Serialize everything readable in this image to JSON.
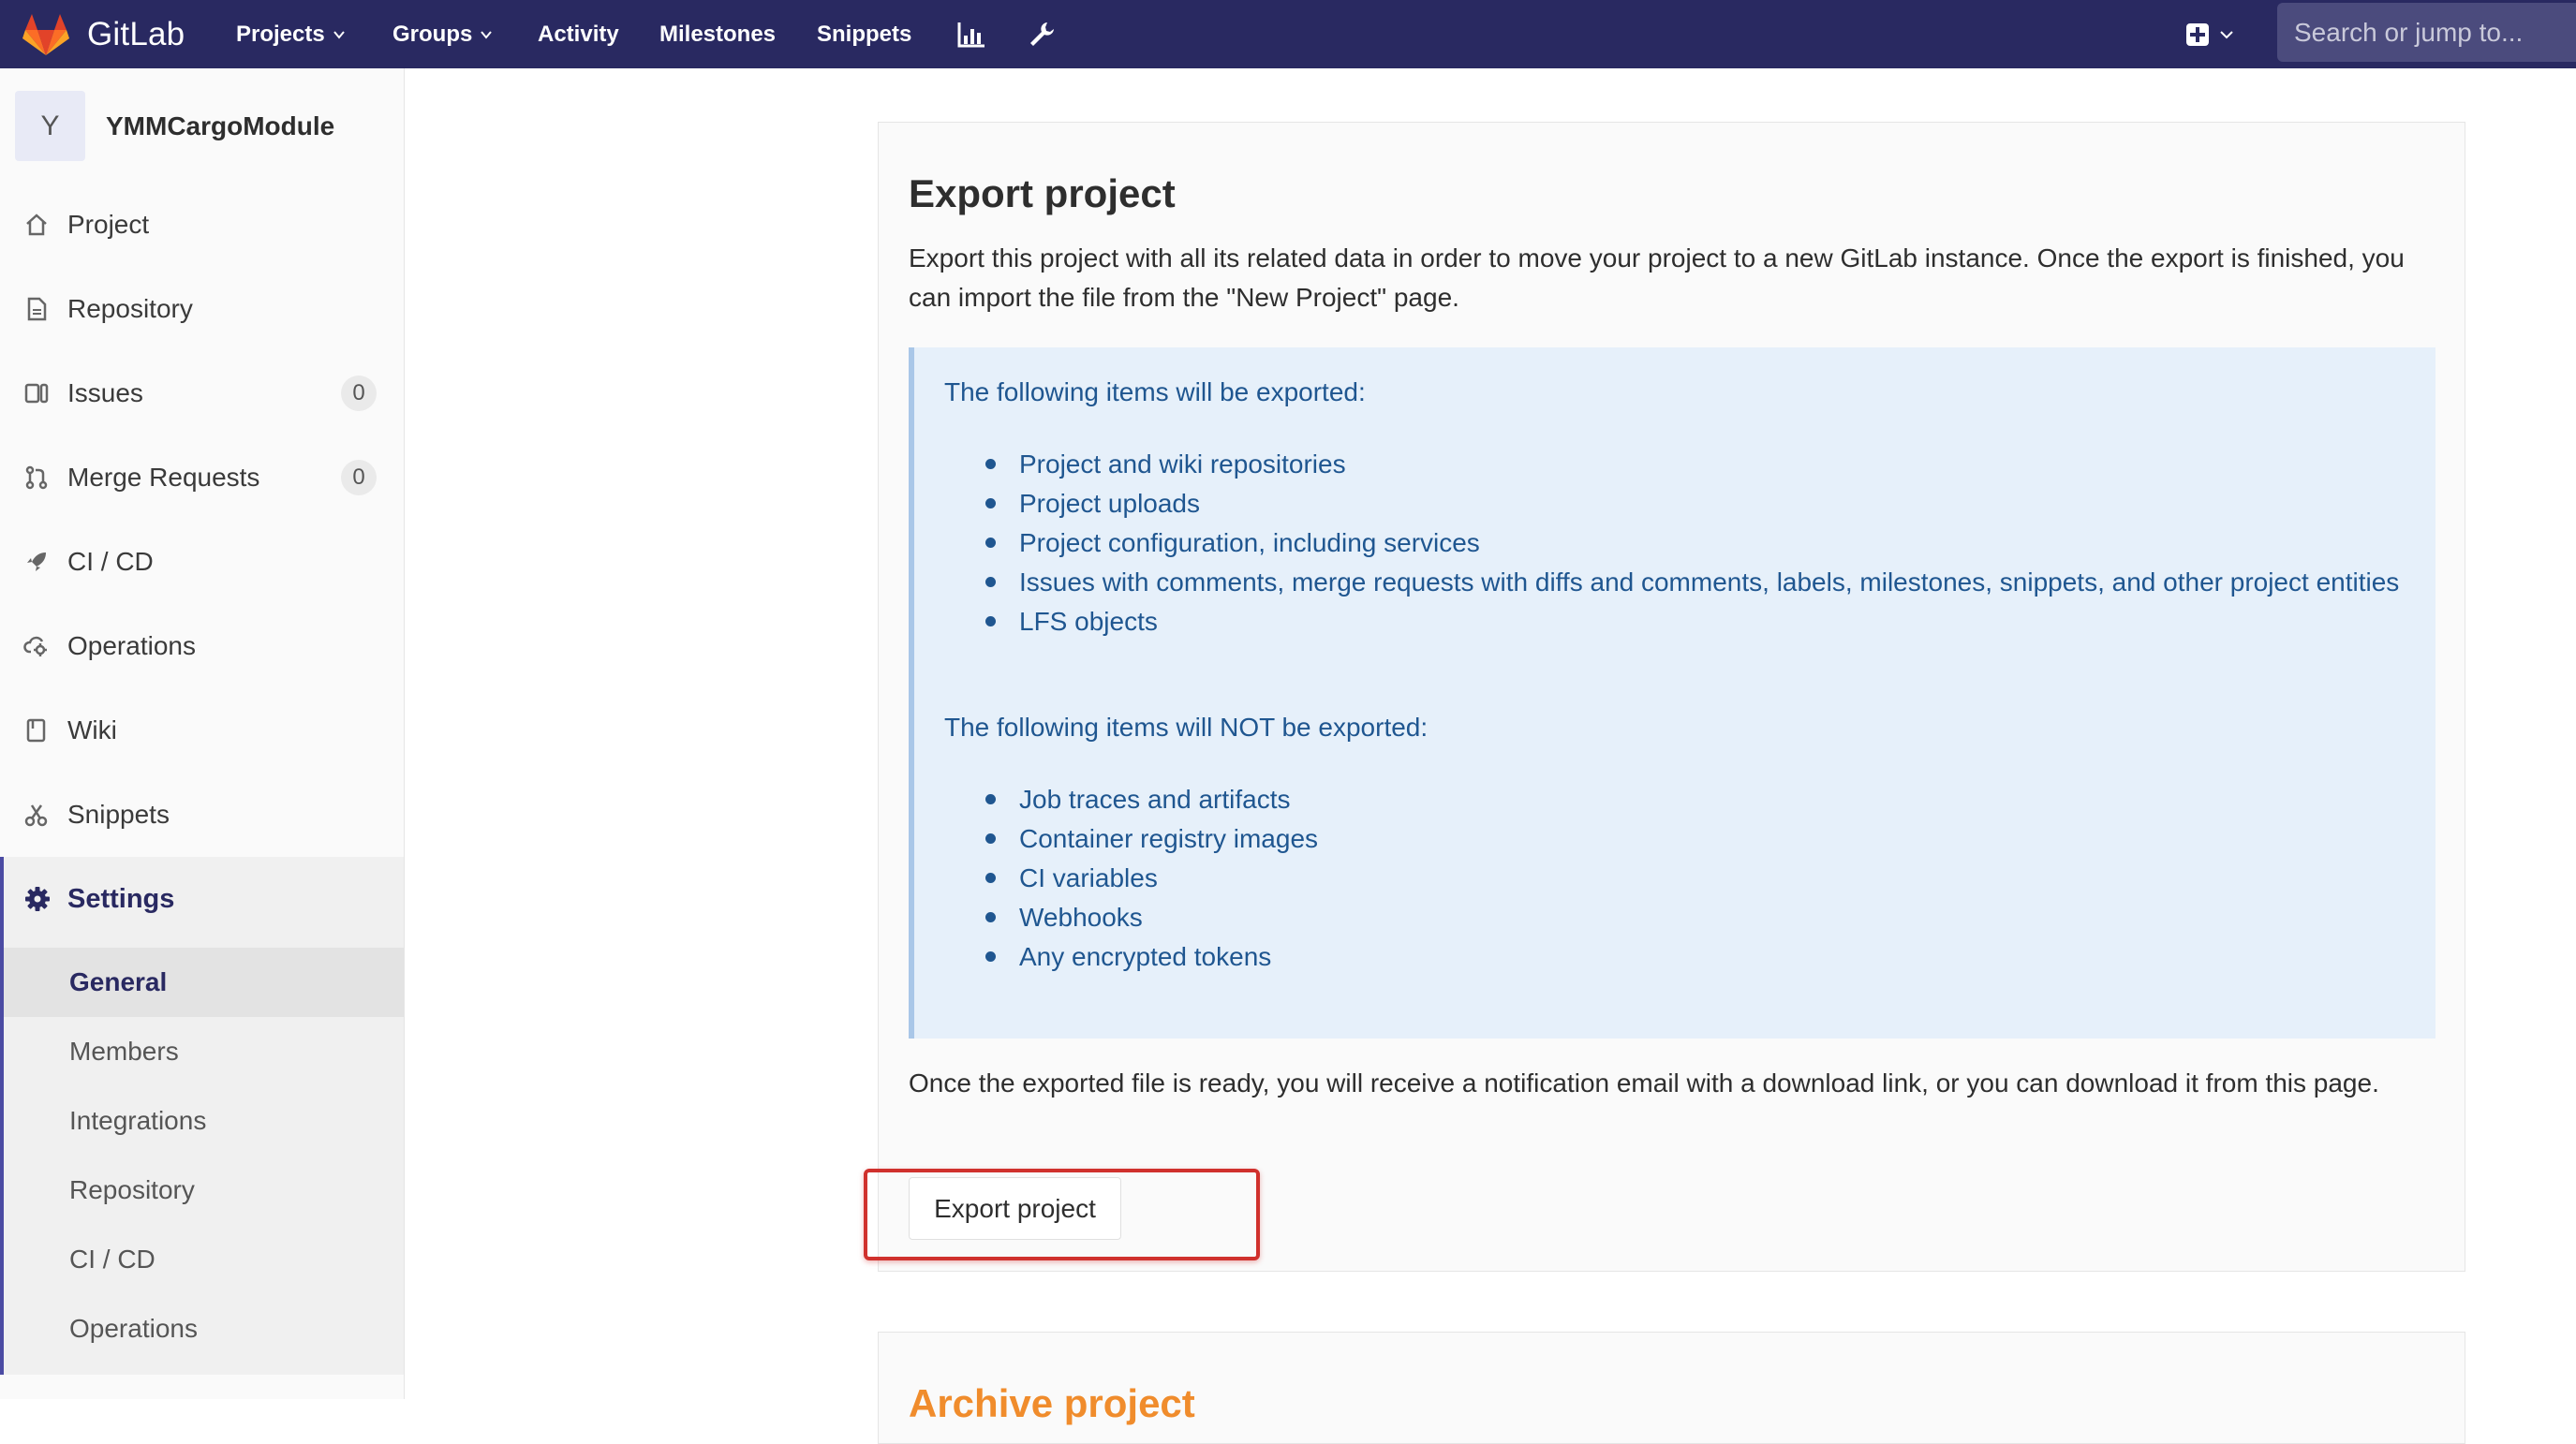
{
  "navbar": {
    "brand": "GitLab",
    "items": [
      {
        "label": "Projects",
        "has_caret": true
      },
      {
        "label": "Groups",
        "has_caret": true
      },
      {
        "label": "Activity",
        "has_caret": false
      },
      {
        "label": "Milestones",
        "has_caret": false
      },
      {
        "label": "Snippets",
        "has_caret": false
      }
    ],
    "icons": [
      "chart-icon",
      "wrench-icon",
      "plus-square-icon"
    ],
    "search_placeholder": "Search or jump to..."
  },
  "sidebar": {
    "avatar_letter": "Y",
    "project_name": "YMMCargoModule",
    "items": [
      {
        "label": "Project",
        "icon": "home-icon"
      },
      {
        "label": "Repository",
        "icon": "document-icon"
      },
      {
        "label": "Issues",
        "icon": "issues-icon",
        "count": "0"
      },
      {
        "label": "Merge Requests",
        "icon": "merge-request-icon",
        "count": "0"
      },
      {
        "label": "CI / CD",
        "icon": "rocket-icon"
      },
      {
        "label": "Operations",
        "icon": "cloud-gear-icon"
      },
      {
        "label": "Wiki",
        "icon": "book-icon"
      },
      {
        "label": "Snippets",
        "icon": "scissors-icon"
      }
    ],
    "settings": {
      "label": "Settings",
      "icon": "gear-icon",
      "subitems": [
        {
          "label": "General",
          "active": true
        },
        {
          "label": "Members",
          "active": false
        },
        {
          "label": "Integrations",
          "active": false
        },
        {
          "label": "Repository",
          "active": false
        },
        {
          "label": "CI / CD",
          "active": false
        },
        {
          "label": "Operations",
          "active": false
        }
      ]
    }
  },
  "export_panel": {
    "title": "Export project",
    "description": "Export this project with all its related data in order to move your project to a new GitLab instance. Once the export is finished, you can import the file from the \"New Project\" page.",
    "exported_heading": "The following items will be exported:",
    "exported_items": [
      "Project and wiki repositories",
      "Project uploads",
      "Project configuration, including services",
      "Issues with comments, merge requests with diffs and comments, labels, milestones, snippets, and other project entities",
      "LFS objects"
    ],
    "not_exported_heading": "The following items will NOT be exported:",
    "not_exported_items": [
      "Job traces and artifacts",
      "Container registry images",
      "CI variables",
      "Webhooks",
      "Any encrypted tokens"
    ],
    "after_text": "Once the exported file is ready, you will receive a notification email with a download link, or you can download it from this page.",
    "button_label": "Export project"
  },
  "archive_panel": {
    "title": "Archive project"
  },
  "colors": {
    "navbar": "#292961",
    "info_text": "#1f5690",
    "info_bg": "#e6f0fa",
    "highlight": "#d0312d",
    "archive_title": "#f08c2c"
  }
}
